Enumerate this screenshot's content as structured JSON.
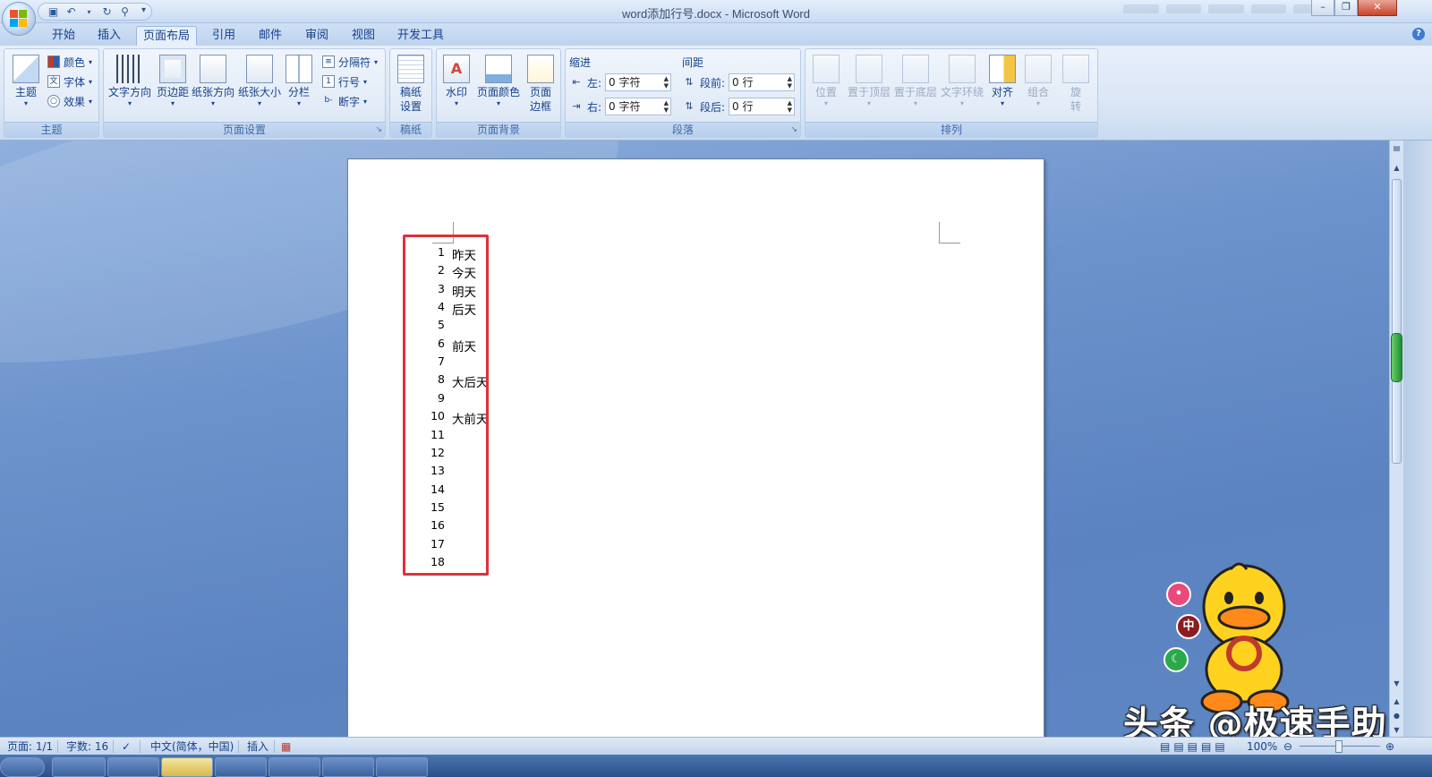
{
  "window": {
    "title": "word添加行号.docx - Microsoft Word"
  },
  "tabs": [
    "开始",
    "插入",
    "页面布局",
    "引用",
    "邮件",
    "审阅",
    "视图",
    "开发工具"
  ],
  "active_tab": "页面布局",
  "ribbon": {
    "theme_group": {
      "label": "主题",
      "theme_button": "主题",
      "colors": "颜色",
      "fonts": "字体",
      "effects": "效果"
    },
    "page_setup_group": {
      "label": "页面设置",
      "text_direction": "文字方向",
      "margins": "页边距",
      "orientation": "纸张方向",
      "size": "纸张大小",
      "columns": "分栏",
      "breaks": "分隔符",
      "line_numbers": "行号",
      "hyphenation": "断字"
    },
    "draft_group": {
      "label": "稿纸",
      "draft_settings_1": "稿纸",
      "draft_settings_2": "设置"
    },
    "background_group": {
      "label": "页面背景",
      "watermark": "水印",
      "page_color": "页面颜色",
      "page_borders_1": "页面",
      "page_borders_2": "边框"
    },
    "paragraph_group": {
      "label": "段落",
      "indent_head": "缩进",
      "spacing_head": "间距",
      "left_label": "左:",
      "left_value": "0 字符",
      "right_label": "右:",
      "right_value": "0 字符",
      "before_label": "段前:",
      "before_value": "0 行",
      "after_label": "段后:",
      "after_value": "0 行"
    },
    "arrange_group": {
      "label": "排列",
      "position": "位置",
      "bring_front": "置于顶层",
      "send_back": "置于底层",
      "text_wrap": "文字环绕",
      "align": "对齐",
      "group": "组合",
      "rotate_1": "旋",
      "rotate_2": "转"
    }
  },
  "document": {
    "lines": [
      {
        "num": "1",
        "text": "昨天"
      },
      {
        "num": "2",
        "text": "今天"
      },
      {
        "num": "3",
        "text": "明天"
      },
      {
        "num": "4",
        "text": "后天"
      },
      {
        "num": "5",
        "text": ""
      },
      {
        "num": "6",
        "text": "前天"
      },
      {
        "num": "7",
        "text": ""
      },
      {
        "num": "8",
        "text": "大后天"
      },
      {
        "num": "9",
        "text": ""
      },
      {
        "num": "10",
        "text": "大前天"
      },
      {
        "num": "11",
        "text": ""
      },
      {
        "num": "12",
        "text": ""
      },
      {
        "num": "13",
        "text": ""
      },
      {
        "num": "14",
        "text": ""
      },
      {
        "num": "15",
        "text": ""
      },
      {
        "num": "16",
        "text": ""
      },
      {
        "num": "17",
        "text": ""
      },
      {
        "num": "18",
        "text": ""
      }
    ],
    "highlight_color": "#e0303c"
  },
  "statusbar": {
    "page": "页面: 1/1",
    "words": "字数: 16",
    "language": "中文(简体，中国)",
    "mode": "插入",
    "zoom": "100%"
  },
  "overlay": {
    "watermark_text": "头条 @极速手助",
    "bubble_middle": "中"
  },
  "colors": {
    "accent": "#15428b",
    "ribbon_bg": "#dbe7f6",
    "workspace": "#6d93cc"
  }
}
